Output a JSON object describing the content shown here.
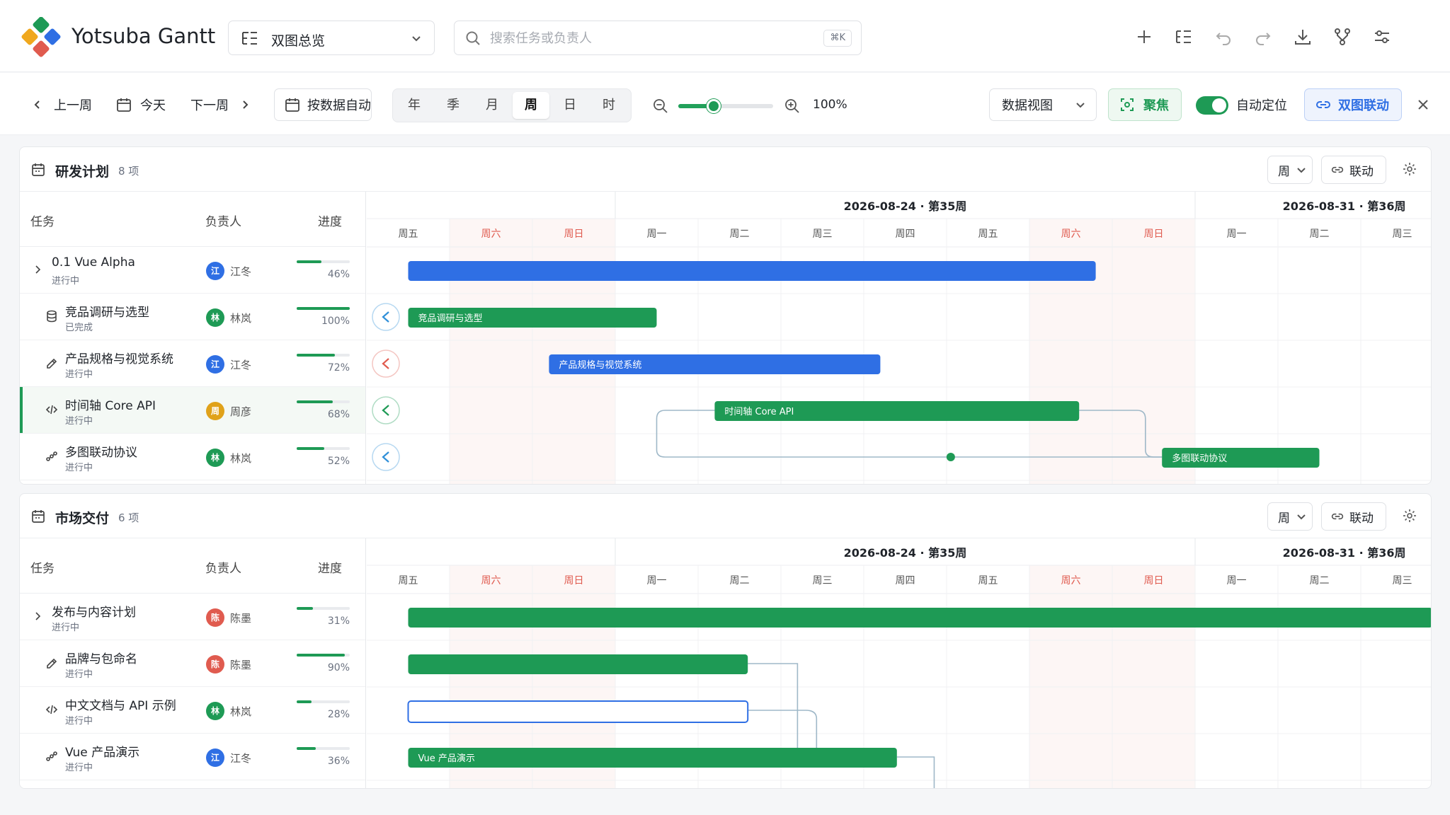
{
  "app": {
    "title": "Yotsuba Gantt",
    "view_select": "双图总览",
    "search_placeholder": "搜索任务或负责人",
    "search_shortcut": "⌘K"
  },
  "toolbar": {
    "prev_week": "上一周",
    "today": "今天",
    "next_week": "下一周",
    "data_auto": "按数据自动",
    "scales": [
      {
        "label": "年"
      },
      {
        "label": "季"
      },
      {
        "label": "月"
      },
      {
        "label": "周",
        "active": true
      },
      {
        "label": "日"
      },
      {
        "label": "时"
      }
    ],
    "zoom_value": 0.37,
    "zoom_label": "100%",
    "data_view": "数据视图",
    "focus": "聚焦",
    "auto_locate": "自动定位",
    "auto_locate_on": true,
    "link_charts": "双图联动"
  },
  "colors": {
    "blue": "#2f6fe4",
    "green": "#1e9a55",
    "accent_blue": "#2f6fe4"
  },
  "columns": {
    "task": "任务",
    "owner": "负责人",
    "progress": "进度"
  },
  "timeline": {
    "weeks": [
      {
        "label": "2026-08-24 · 第35周"
      },
      {
        "label": "2026-08-31 · 第36周"
      }
    ],
    "days": [
      "周五",
      "周六",
      "周日",
      "周一",
      "周二",
      "周三",
      "周四",
      "周五",
      "周六",
      "周日",
      "周一",
      "周二",
      "周三"
    ],
    "weekend": [
      1,
      2,
      8,
      9
    ]
  },
  "panels": [
    {
      "title": "研发计划",
      "count": "8 项",
      "scale_btn": "周",
      "link_btn": "联动",
      "rows": [
        {
          "name": "0.1 Vue Alpha",
          "status": "进行中",
          "owner": "江冬",
          "avatar": "江",
          "avatar_color": "#2f6fe4",
          "progress": 46,
          "pct": "46%",
          "type": "group",
          "icon": "chevron-right-icon"
        },
        {
          "name": "竞品调研与选型",
          "status": "已完成",
          "owner": "林岚",
          "avatar": "林",
          "avatar_color": "#1e9a55",
          "progress": 100,
          "pct": "100%",
          "icon": "database-icon"
        },
        {
          "name": "产品规格与视觉系统",
          "status": "进行中",
          "owner": "江冬",
          "avatar": "江",
          "avatar_color": "#2f6fe4",
          "progress": 72,
          "pct": "72%",
          "icon": "palette-icon"
        },
        {
          "name": "时间轴 Core API",
          "status": "进行中",
          "owner": "周彦",
          "avatar": "周",
          "avatar_color": "#e0a21a",
          "progress": 68,
          "pct": "68%",
          "icon": "code-icon",
          "selected": true
        },
        {
          "name": "多图联动协议",
          "status": "进行中",
          "owner": "林岚",
          "avatar": "林",
          "avatar_color": "#1e9a55",
          "progress": 52,
          "pct": "52%",
          "icon": "network-icon"
        }
      ],
      "bars": [
        {
          "row": 0,
          "start": 0.5,
          "end": 8.8,
          "color": "blue",
          "label": ""
        },
        {
          "row": 1,
          "start": 0.5,
          "end": 3.5,
          "color": "green",
          "label": "竞品调研与选型"
        },
        {
          "row": 2,
          "start": 2.2,
          "end": 6.2,
          "color": "blue",
          "label": "产品规格与视觉系统"
        },
        {
          "row": 3,
          "start": 4.2,
          "end": 8.6,
          "color": "green",
          "label": "时间轴 Core API"
        },
        {
          "row": 4,
          "start": 9.6,
          "end": 11.5,
          "color": "green",
          "label": "多图联动协议"
        }
      ],
      "markers": [
        {
          "row": 1,
          "color": "#2f8fd8"
        },
        {
          "row": 2,
          "color": "#e05b4f"
        },
        {
          "row": 3,
          "color": "#1e9a55"
        },
        {
          "row": 4,
          "color": "#2f8fd8"
        }
      ]
    },
    {
      "title": "市场交付",
      "count": "6 项",
      "scale_btn": "周",
      "link_btn": "联动",
      "rows": [
        {
          "name": "发布与内容计划",
          "status": "进行中",
          "owner": "陈墨",
          "avatar": "陈",
          "avatar_color": "#e05b4f",
          "progress": 31,
          "pct": "31%",
          "type": "group",
          "icon": "chevron-right-icon"
        },
        {
          "name": "品牌与包命名",
          "status": "进行中",
          "owner": "陈墨",
          "avatar": "陈",
          "avatar_color": "#e05b4f",
          "progress": 90,
          "pct": "90%",
          "icon": "palette-icon"
        },
        {
          "name": "中文文档与 API 示例",
          "status": "进行中",
          "owner": "林岚",
          "avatar": "林",
          "avatar_color": "#1e9a55",
          "progress": 28,
          "pct": "28%",
          "icon": "code-icon"
        },
        {
          "name": "Vue 产品演示",
          "status": "进行中",
          "owner": "江冬",
          "avatar": "江",
          "avatar_color": "#2f6fe4",
          "progress": 36,
          "pct": "36%",
          "icon": "network-icon"
        }
      ],
      "bars": [
        {
          "row": 0,
          "start": 0.5,
          "end": 13.5,
          "color": "green",
          "label": ""
        },
        {
          "row": 1,
          "start": 0.5,
          "end": 4.6,
          "color": "green",
          "label": ""
        },
        {
          "row": 2,
          "start": 0.5,
          "end": 4.6,
          "color": "outline",
          "label": ""
        },
        {
          "row": 3,
          "start": 0.5,
          "end": 6.4,
          "color": "green",
          "label": "Vue 产品演示"
        }
      ],
      "markers": []
    }
  ]
}
